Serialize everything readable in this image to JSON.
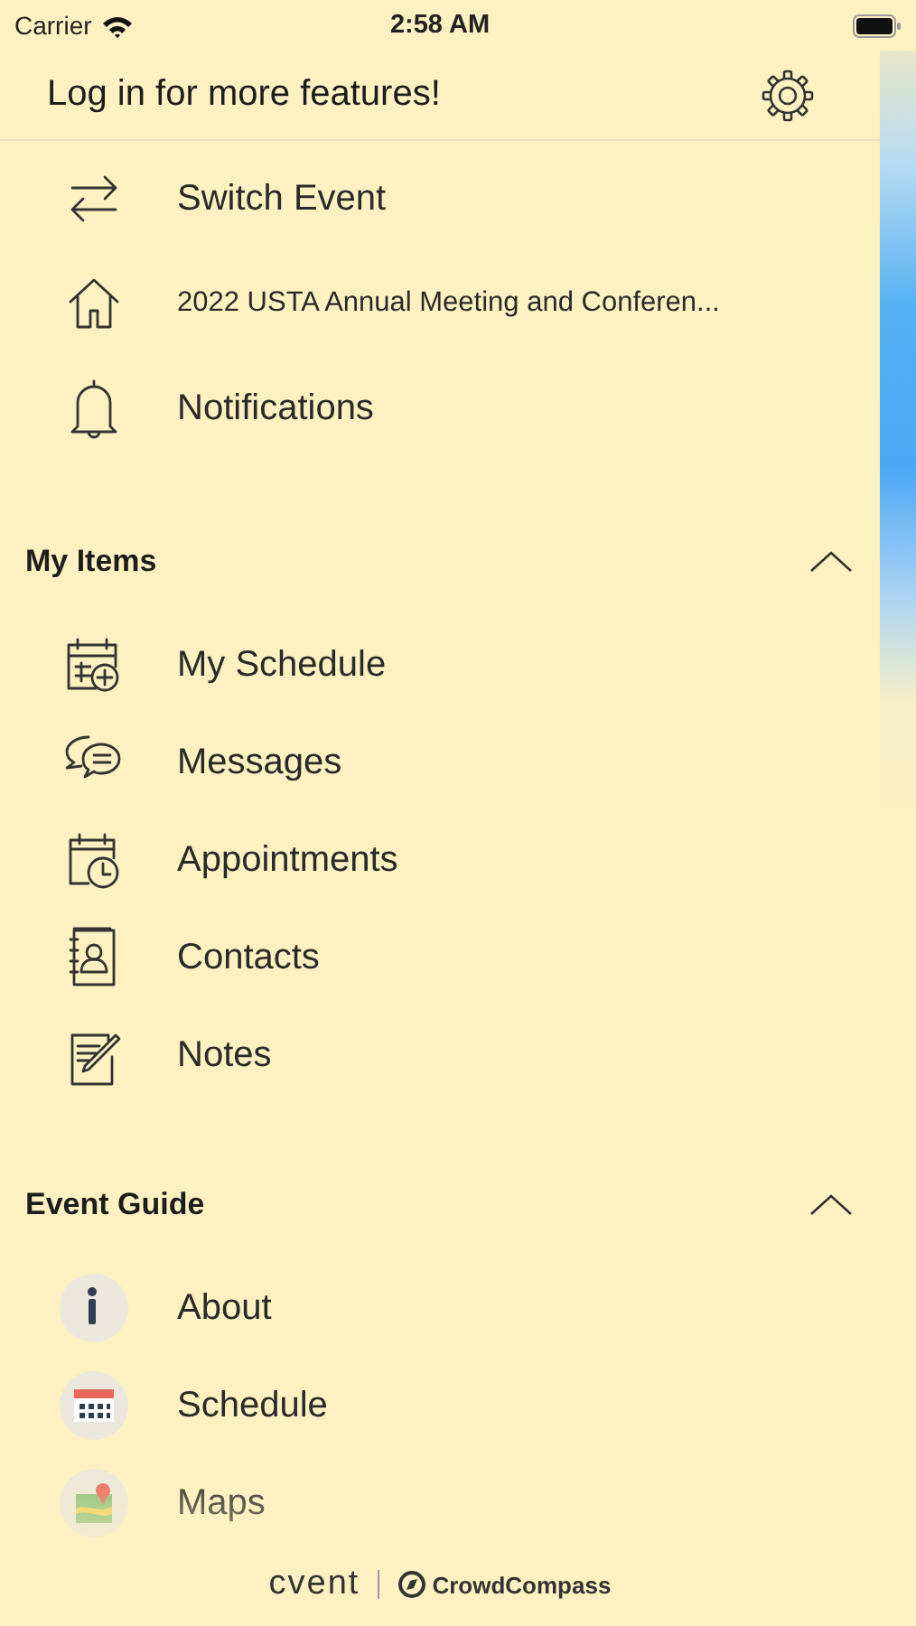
{
  "status_bar": {
    "carrier": "Carrier",
    "time": "2:58 AM"
  },
  "header": {
    "title": "Log in for more features!"
  },
  "top_items": [
    {
      "label": "Switch Event",
      "kind": "large"
    },
    {
      "label": "2022 USTA Annual Meeting and Conferen...",
      "kind": "small"
    },
    {
      "label": "Notifications",
      "kind": "large"
    }
  ],
  "sections": [
    {
      "title": "My Items",
      "expanded": true,
      "kind": "line",
      "items": [
        {
          "label": "My Schedule"
        },
        {
          "label": "Messages"
        },
        {
          "label": "Appointments"
        },
        {
          "label": "Contacts"
        },
        {
          "label": "Notes"
        }
      ]
    },
    {
      "title": "Event Guide",
      "expanded": true,
      "kind": "round",
      "items": [
        {
          "label": "About"
        },
        {
          "label": "Schedule"
        },
        {
          "label": "Maps"
        }
      ]
    }
  ],
  "footer": {
    "brand": "cvent",
    "partner": "CrowdCompass"
  }
}
